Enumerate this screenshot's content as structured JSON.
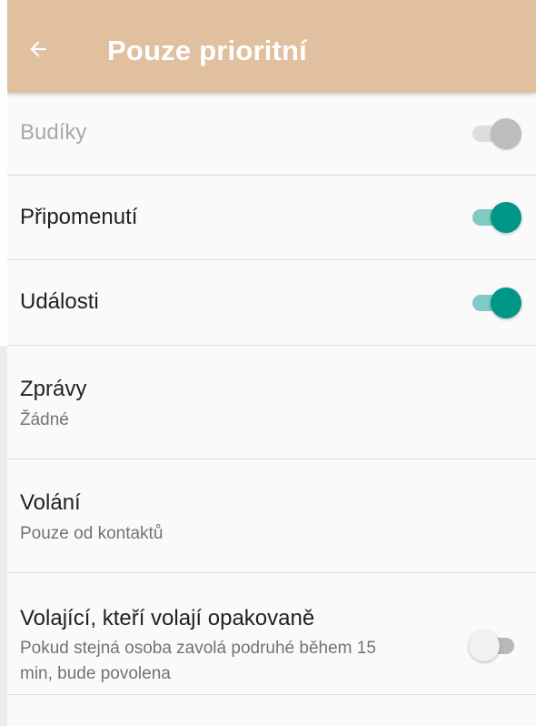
{
  "header": {
    "title": "Pouze prioritní",
    "back_icon": "arrow-back-icon",
    "background": "#e0c09e"
  },
  "settings": [
    {
      "label": "Budíky",
      "state": "on",
      "enabled": false
    },
    {
      "label": "Připomenutí",
      "state": "on",
      "enabled": true
    },
    {
      "label": "Události",
      "state": "on",
      "enabled": true
    },
    {
      "label": "Zprávy",
      "summary": "Žádné"
    },
    {
      "label": "Volání",
      "summary": "Pouze od kontaktů"
    },
    {
      "label": "Volající, kteří volají opakovaně",
      "summary": "Pokud stejná osoba zavolá podruhé během 15 min, bude povolena",
      "state": "off",
      "enabled": true
    }
  ],
  "colors": {
    "accent": "#009688",
    "accent_track": "#80cbc4",
    "text_primary": "#212121",
    "text_secondary": "#737373",
    "text_disabled": "#a8a8a8"
  }
}
